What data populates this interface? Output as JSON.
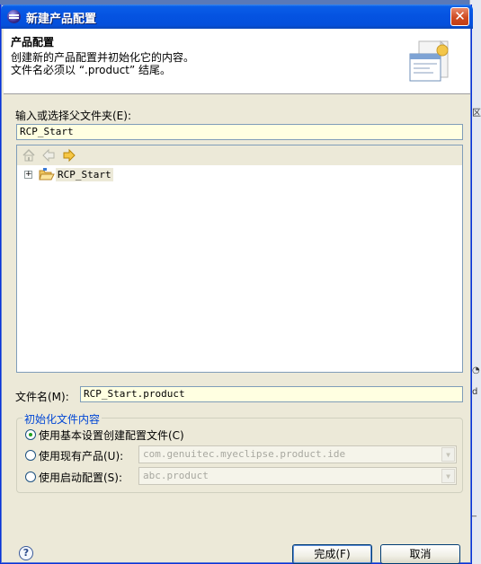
{
  "window": {
    "title": "新建产品配置",
    "close_glyph": "✕"
  },
  "header": {
    "title": "产品配置",
    "description_line1": "创建新的产品配置并初始化它的内容。",
    "description_line2": "文件名必须以 “.product” 结尾。",
    "icon": "wizard-banner-icon"
  },
  "folder": {
    "label": "输入或选择父文件夹(E):",
    "value": "RCP_Start"
  },
  "tree": {
    "toolbar": [
      "home-icon",
      "back-arrow-icon",
      "forward-arrow-icon"
    ],
    "items": [
      {
        "label": "RCP_Start",
        "expander": "+",
        "icon": "open-folder-icon"
      }
    ]
  },
  "filename": {
    "label": "文件名(M):",
    "value": "RCP_Start.product"
  },
  "init_group": {
    "title": "初始化文件内容",
    "options": [
      {
        "label": "使用基本设置创建配置文件(C)",
        "selected": true
      },
      {
        "label": "使用现有产品(U):",
        "selected": false,
        "combo_value": "com.genuitec.myeclipse.product.ide"
      },
      {
        "label": "使用启动配置(S):",
        "selected": false,
        "combo_value": "abc.product"
      }
    ]
  },
  "footer": {
    "help_glyph": "?",
    "finish_label": "完成(F)",
    "cancel_label": "取消"
  },
  "colors": {
    "titlebar": "#0553e1",
    "field_bg": "#ffffe1",
    "dialog_bg": "#ece9d8",
    "group_title": "#0046d5"
  }
}
